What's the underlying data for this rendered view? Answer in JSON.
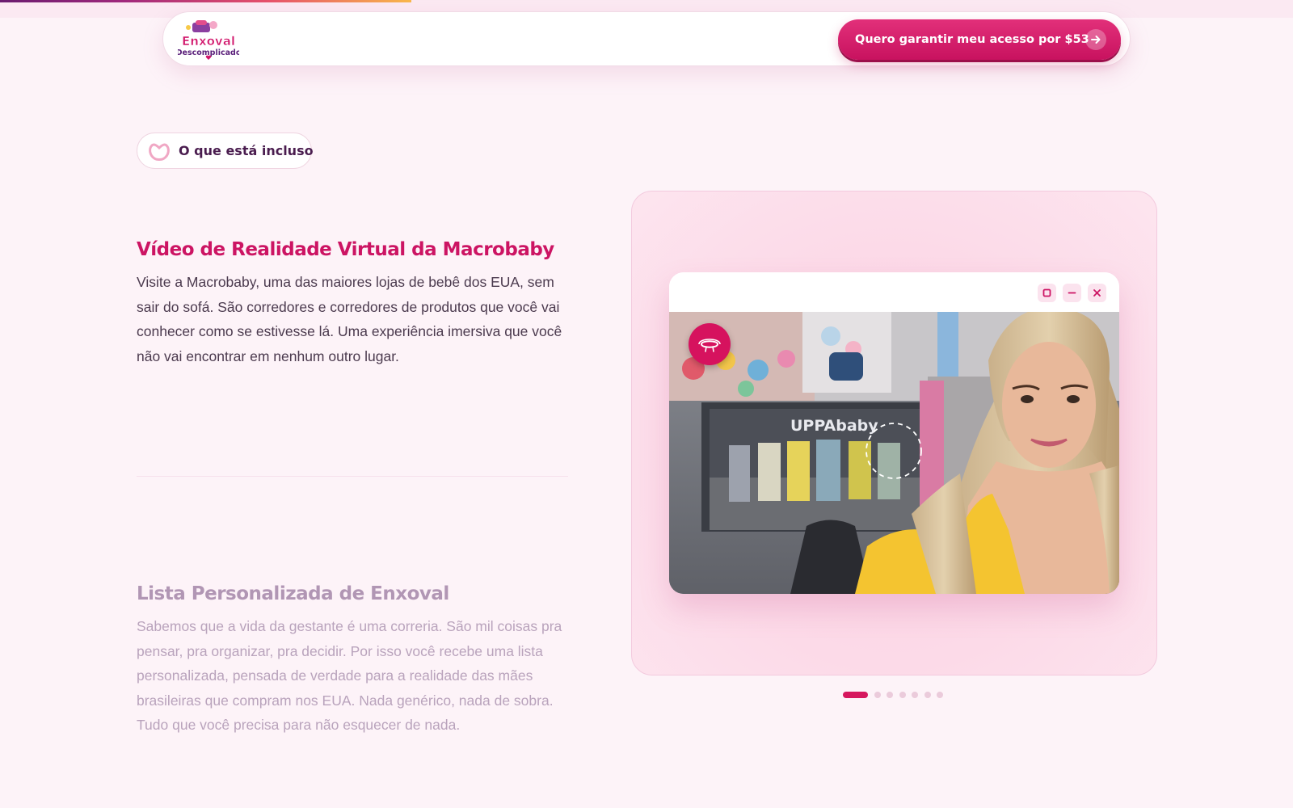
{
  "page": {
    "reading_progress": 0.318
  },
  "header": {
    "logo_line1": "Enxoval",
    "logo_line2": "Descomplicado",
    "cta_label": "Quero garantir meu acesso por $53"
  },
  "section": {
    "badge_label": "O que está incluso"
  },
  "features": [
    {
      "title": "Vídeo de Realidade Virtual da Macrobaby",
      "description": "Visite a Macrobaby, uma das maiores lojas de bebê dos EUA, sem sair do sofá. São corredores e corredores de produtos que você vai conhecer como se estivesse lá. Uma experiência imersiva que você não vai encontrar em nenhum outro lugar.",
      "active": true
    },
    {
      "title": "Lista Personalizada de Enxoval",
      "description": "Sabemos que a vida da gestante é uma correria. São mil coisas pra pensar, pra organizar, pra decidir. Por isso você recebe uma lista personalizada, pensada de verdade para a realidade das mães brasileiras que compram nos EUA. Nada genérico, nada de sobra. Tudo que você precisa para não esquecer de nada.",
      "active": false
    }
  ],
  "media": {
    "store_sign": "UPPAbaby",
    "icons": {
      "vr": "vr-headset-icon",
      "maximize": "square-icon",
      "minimize": "minus-icon",
      "close": "close-icon"
    }
  },
  "carousel": {
    "total": 7,
    "active_index": 0
  },
  "colors": {
    "brand_pink": "#cc1463",
    "brand_purple": "#4a1d4f",
    "background": "#fdf3f8"
  }
}
